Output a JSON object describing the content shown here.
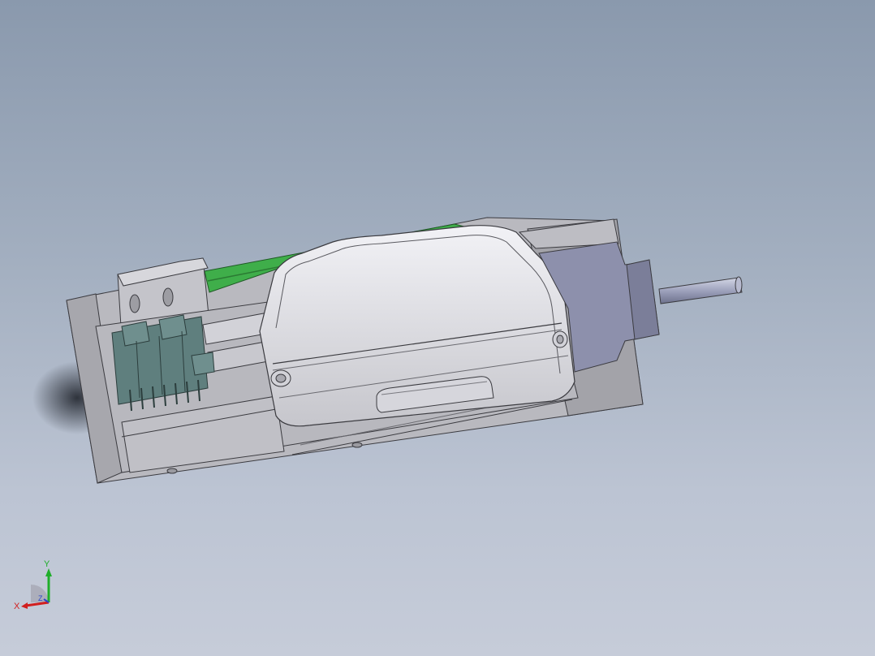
{
  "viewport": {
    "background_top": "#8a99ad",
    "background_bottom": "#c6ccd9"
  },
  "model": {
    "accent_green": "#3fae4a",
    "connector_color": "#5f7f7e",
    "motor_color": "#8d90ac",
    "body_color": "#c9c9ce"
  },
  "triad": {
    "x_label": "X",
    "y_label": "Y",
    "z_label": "Z",
    "x_color": "#d11f1f",
    "y_color": "#1fae2a",
    "z_color": "#2a46c8"
  }
}
